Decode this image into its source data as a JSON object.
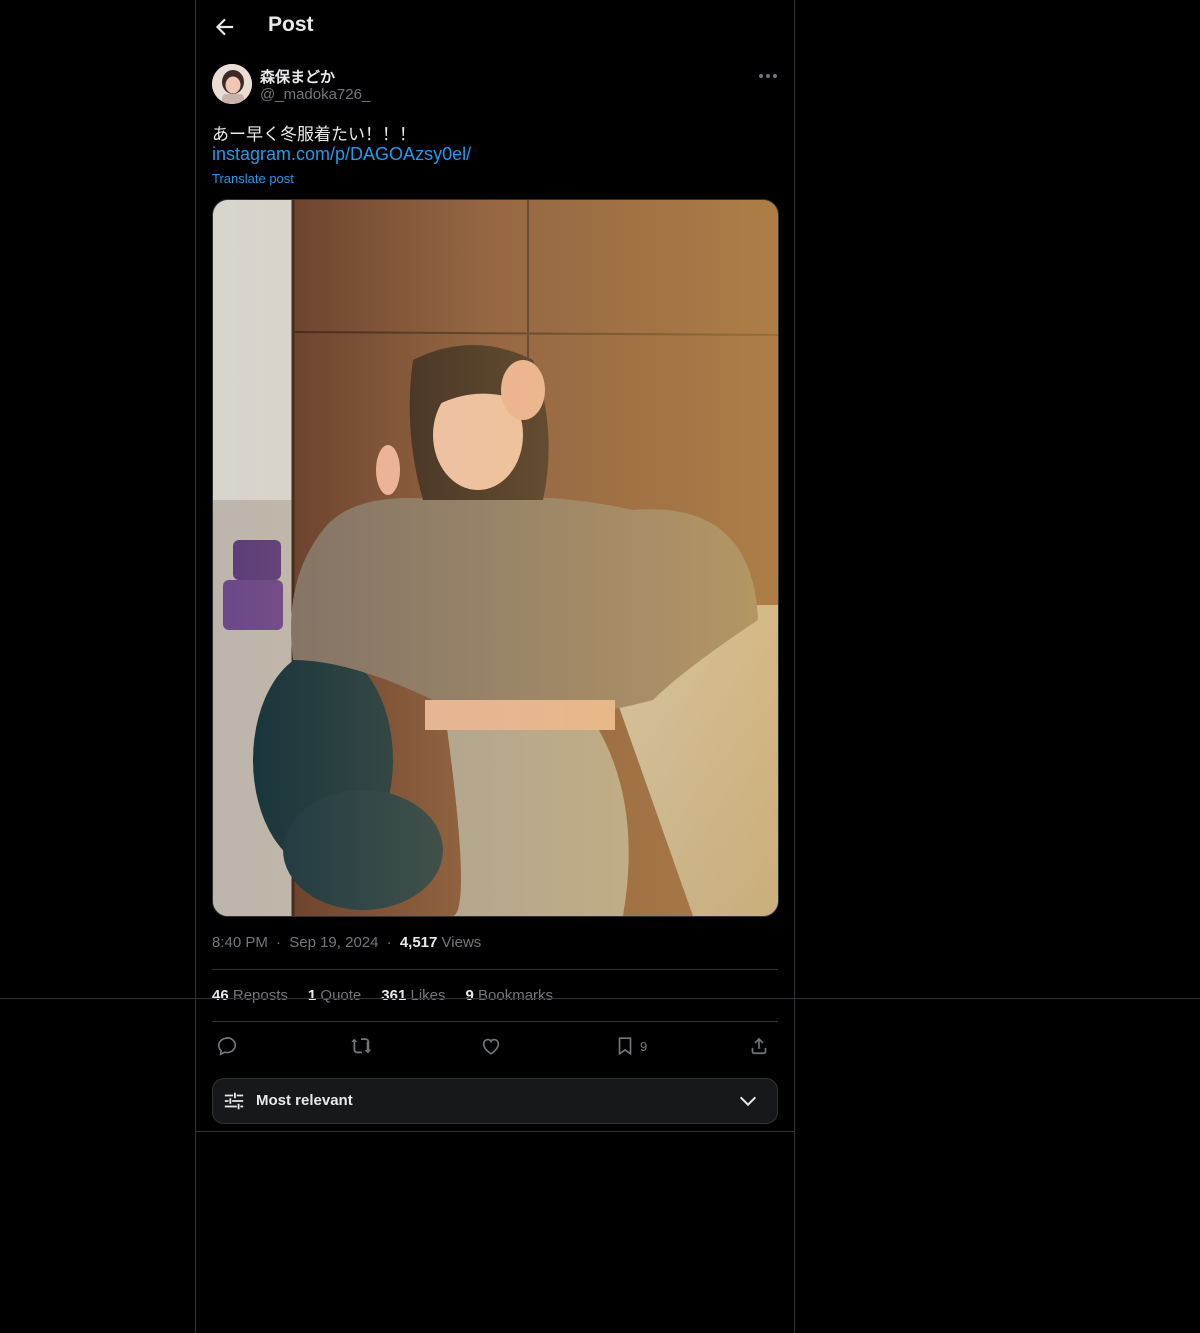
{
  "header": {
    "title": "Post",
    "back_icon": "arrow-left-icon"
  },
  "post": {
    "author_name": "森保まどか",
    "author_handle": "@_madoka726_",
    "text": "あー早く冬服着たい！！！",
    "link": "instagram.com/p/DAGOAzsy0el/",
    "translate_label": "Translate post",
    "time": "8:40 PM",
    "date": "Sep 19, 2024",
    "separator": "·",
    "views_count": "4,517",
    "views_label": "Views"
  },
  "stats": {
    "reposts_count": "46",
    "reposts_label": "Reposts",
    "quotes_count": "1",
    "quotes_label": "Quote",
    "likes_count": "361",
    "likes_label": "Likes",
    "bookmarks_count": "9",
    "bookmarks_label": "Bookmarks"
  },
  "actions": {
    "bookmark_count": "9"
  },
  "sort": {
    "label": "Most relevant"
  },
  "colors": {
    "accent": "#1d9bf0",
    "background": "#000000",
    "muted": "#71767b",
    "border": "#2f3336"
  }
}
